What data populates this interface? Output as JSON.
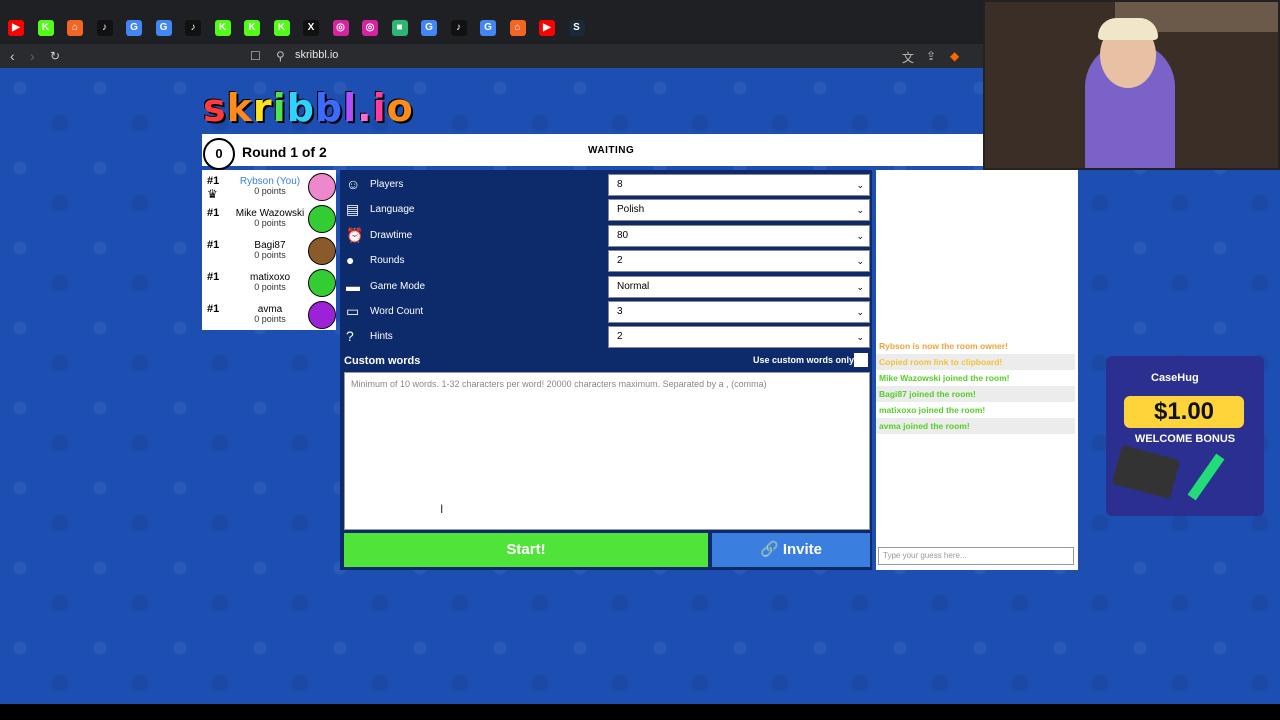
{
  "browser": {
    "url": "skribbl.io",
    "tabs": [
      {
        "icon": "youtube-icon",
        "color": "#ff0000",
        "glyph": "▶"
      },
      {
        "icon": "kick-icon",
        "color": "#53fc18",
        "glyph": "K"
      },
      {
        "icon": "home-icon",
        "color": "#f26522",
        "glyph": "⌂"
      },
      {
        "icon": "tiktok-icon",
        "color": "#111111",
        "glyph": "♪"
      },
      {
        "icon": "google-icon",
        "color": "#4285f4",
        "glyph": "G"
      },
      {
        "icon": "google-icon",
        "color": "#4285f4",
        "glyph": "G"
      },
      {
        "icon": "tiktok-icon",
        "color": "#111111",
        "glyph": "♪"
      },
      {
        "icon": "kick-icon",
        "color": "#53fc18",
        "glyph": "K"
      },
      {
        "icon": "kick-icon",
        "color": "#53fc18",
        "glyph": "K"
      },
      {
        "icon": "kick-icon",
        "color": "#53fc18",
        "glyph": "K"
      },
      {
        "icon": "x-icon",
        "color": "#111111",
        "glyph": "X"
      },
      {
        "icon": "instagram-icon",
        "color": "#d6249f",
        "glyph": "◎"
      },
      {
        "icon": "instagram-icon",
        "color": "#d6249f",
        "glyph": "◎"
      },
      {
        "icon": "app-icon",
        "color": "#2bb673",
        "glyph": "■"
      },
      {
        "icon": "google-icon",
        "color": "#4285f4",
        "glyph": "G"
      },
      {
        "icon": "tiktok-icon",
        "color": "#111111",
        "glyph": "♪"
      },
      {
        "icon": "google-icon",
        "color": "#4285f4",
        "glyph": "G"
      },
      {
        "icon": "home-icon",
        "color": "#f26522",
        "glyph": "⌂"
      },
      {
        "icon": "youtube-icon",
        "color": "#ff0000",
        "glyph": "▶"
      },
      {
        "icon": "steam-icon",
        "color": "#1b2838",
        "glyph": "S"
      }
    ]
  },
  "game": {
    "logo": "skribbl.io",
    "logo_letters": [
      {
        "ch": "s",
        "color": "#ff3b3b"
      },
      {
        "ch": "k",
        "color": "#ff8c1a"
      },
      {
        "ch": "r",
        "color": "#ffe21a"
      },
      {
        "ch": "i",
        "color": "#4fe34f"
      },
      {
        "ch": "b",
        "color": "#2fd3ff"
      },
      {
        "ch": "b",
        "color": "#3b6bff"
      },
      {
        "ch": "l",
        "color": "#b04fff"
      },
      {
        "ch": ".",
        "color": "#ff6bd6"
      },
      {
        "ch": "i",
        "color": "#ff3b9d"
      },
      {
        "ch": "o",
        "color": "#ff8c1a"
      }
    ],
    "timer": "0",
    "round": "Round 1 of 2",
    "status": "WAITING"
  },
  "players": [
    {
      "rank": "#1",
      "name": "Rybson (You)",
      "points": "0 points",
      "avatar_color": "#ee88cc",
      "is_you": true,
      "owner": true
    },
    {
      "rank": "#1",
      "name": "Mike Wazowski",
      "points": "0 points",
      "avatar_color": "#33cc33",
      "is_you": false,
      "owner": false
    },
    {
      "rank": "#1",
      "name": "Bagi87",
      "points": "0 points",
      "avatar_color": "#8b5a2b",
      "is_you": false,
      "owner": false
    },
    {
      "rank": "#1",
      "name": "matixoxo",
      "points": "0 points",
      "avatar_color": "#33cc33",
      "is_you": false,
      "owner": false
    },
    {
      "rank": "#1",
      "name": "avma",
      "points": "0 points",
      "avatar_color": "#9b22d6",
      "is_you": false,
      "owner": false
    }
  ],
  "settings": [
    {
      "label": "Players",
      "value": "8",
      "icon": "players-icon"
    },
    {
      "label": "Language",
      "value": "Polish",
      "icon": "language-icon"
    },
    {
      "label": "Drawtime",
      "value": "80",
      "icon": "clock-icon"
    },
    {
      "label": "Rounds",
      "value": "2",
      "icon": "rounds-icon"
    },
    {
      "label": "Game Mode",
      "value": "Normal",
      "icon": "gamemode-icon"
    },
    {
      "label": "Word Count",
      "value": "3",
      "icon": "wordcount-icon"
    },
    {
      "label": "Hints",
      "value": "2",
      "icon": "hint-icon"
    }
  ],
  "custom_words": {
    "title": "Custom words",
    "only_label": "Use custom words only",
    "placeholder": "Minimum of 10 words. 1-32 characters per word! 20000 characters maximum. Separated by a , (comma)"
  },
  "buttons": {
    "start": "Start!",
    "invite": "Invite"
  },
  "chat": {
    "messages": [
      {
        "text": "Rybson is now the room owner!",
        "color": "#f0a23a"
      },
      {
        "text": "Copied room link to clipboard!",
        "color": "#f0c33a"
      },
      {
        "text": "Mike Wazowski joined the room!",
        "color": "#56ce27"
      },
      {
        "text": "Bagi87 joined the room!",
        "color": "#56ce27"
      },
      {
        "text": "matixoxo joined the room!",
        "color": "#56ce27"
      },
      {
        "text": "avma joined the room!",
        "color": "#56ce27"
      }
    ],
    "input_placeholder": "Type your guess here..."
  },
  "ad": {
    "brand": "CaseHug",
    "amount": "$1.00",
    "bonus": "WELCOME BONUS"
  }
}
